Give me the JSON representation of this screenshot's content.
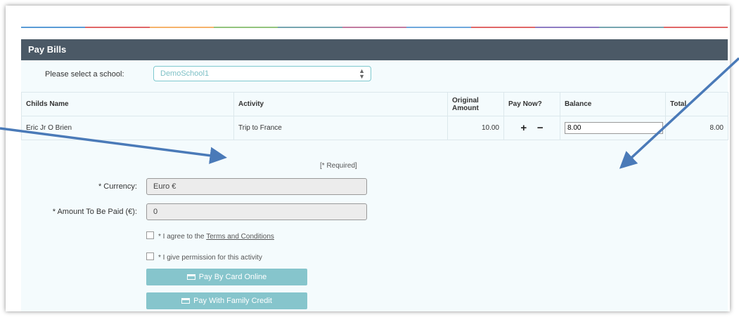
{
  "panel": {
    "title": "Pay Bills"
  },
  "school": {
    "label": "Please select a school:",
    "selected": "DemoSchool1"
  },
  "table": {
    "headers": {
      "child": "Childs Name",
      "activity": "Activity",
      "original_line1": "Original",
      "original_line2": "Amount",
      "pay_now": "Pay Now?",
      "balance": "Balance",
      "total": "Total"
    },
    "rows": [
      {
        "child": "Eric Jr O Brien",
        "activity": "Trip to France",
        "original": "10.00",
        "plus": "+",
        "minus": "−",
        "balance": "8.00",
        "total": "8.00"
      }
    ]
  },
  "form": {
    "required_note": "[* Required]",
    "currency_label": "* Currency:",
    "currency_value": "Euro €",
    "amount_label": "* Amount To Be Paid (€):",
    "amount_value": "0",
    "agree_prefix": "* I agree to the",
    "terms_link": "Terms and Conditions",
    "permission": "* I give permission for this activity",
    "pay_card": "Pay By Card Online",
    "pay_credit": "Pay With Family Credit"
  },
  "colors": {
    "header_bg": "#4b5966",
    "panel_bg": "#f4fbfd",
    "button_bg": "#86c5cc",
    "arrow": "#4a7ab8",
    "stripe": [
      "#5a9bd5",
      "#e06666",
      "#f6b26b",
      "#93c47d",
      "#76a5af",
      "#c27ba0",
      "#6fa8dc",
      "#e06666",
      "#8e7cc3",
      "#76a5af",
      "#e06666"
    ]
  }
}
